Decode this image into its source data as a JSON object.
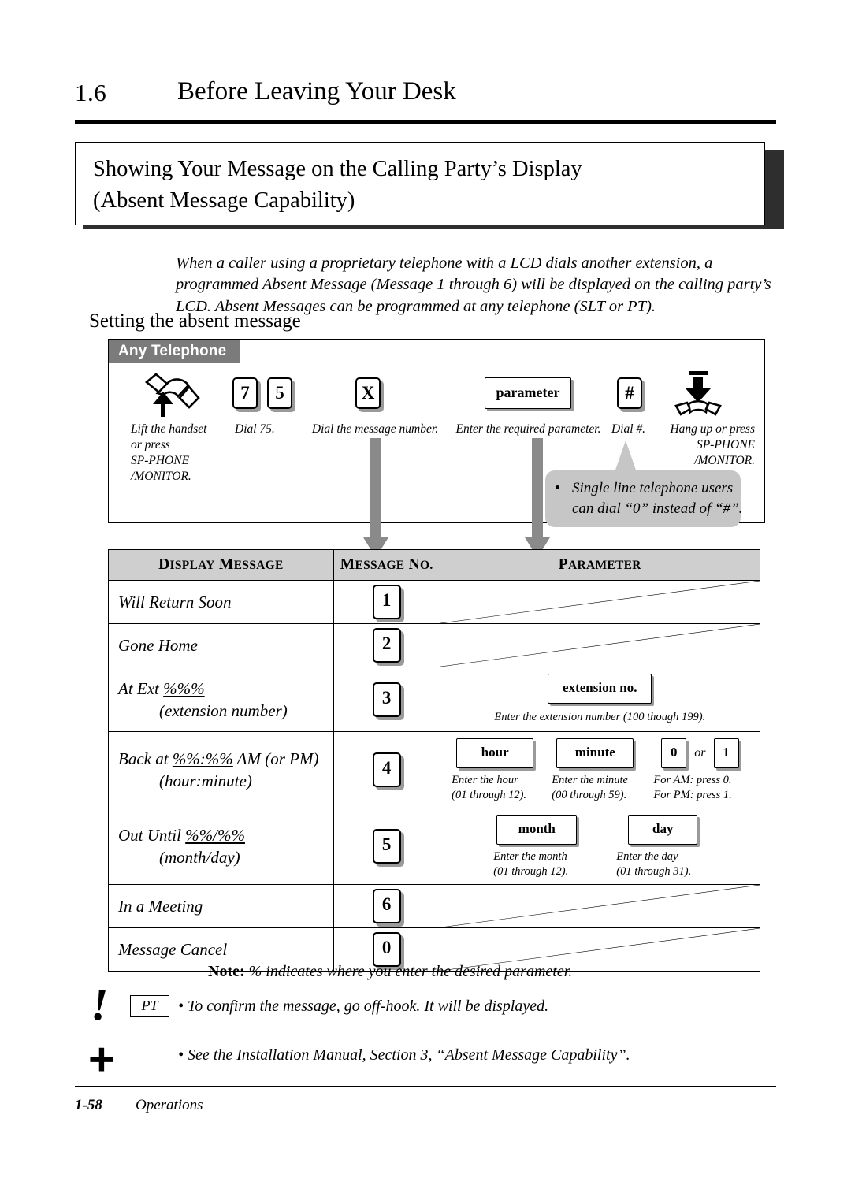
{
  "header": {
    "section_number": "1.6",
    "section_title": "Before Leaving Your Desk"
  },
  "feature": {
    "title_line1": "Showing Your Message on the Calling Party’s Display",
    "title_line2": "(Absent Message Capability)"
  },
  "intro": "When a caller using a proprietary telephone with a LCD dials another extension, a programmed Absent Message (Message 1 through 6) will be displayed on the calling party’s LCD. Absent Messages can be programmed at any telephone (SLT or PT).",
  "subheading": "Setting the absent message",
  "panel": {
    "tab_label": "Any Telephone",
    "steps": [
      {
        "icon": "lift-handset-icon",
        "keys": [],
        "caption": "Lift the handset\nor press\nSP-PHONE\n/MONITOR."
      },
      {
        "icon": null,
        "keys": [
          "7",
          "5"
        ],
        "caption": "Dial 75."
      },
      {
        "icon": null,
        "keys": [
          "X"
        ],
        "caption": "Dial the message number."
      },
      {
        "icon": null,
        "keys": [
          "parameter"
        ],
        "caption": "Enter the required parameter."
      },
      {
        "icon": null,
        "keys": [
          "#"
        ],
        "caption": "Dial #."
      },
      {
        "icon": "hang-up-icon",
        "keys": [],
        "caption": "Hang up or press\nSP-PHONE\n/MONITOR."
      }
    ],
    "callout": {
      "bullet": "•",
      "line1": "Single line telephone users",
      "line2": "can dial “0” instead of “#”."
    }
  },
  "table": {
    "columns": [
      "Display Message",
      "Message No.",
      "Parameter"
    ],
    "rows": [
      {
        "display_message": "Will Return Soon",
        "display_message_sub": "",
        "message_no": "1",
        "parameter_type": "none"
      },
      {
        "display_message": "Gone Home",
        "display_message_sub": "",
        "message_no": "2",
        "parameter_type": "none"
      },
      {
        "display_message": "At Ext %%%",
        "display_message_sub": "(extension number)",
        "message_no": "3",
        "parameter_type": "fields",
        "fields": [
          {
            "box": "extension no.",
            "caption": "Enter the extension number (100 though 199)."
          }
        ]
      },
      {
        "display_message": "Back at %%:%% AM (or PM)",
        "display_message_sub": "(hour:minute)",
        "message_no": "4",
        "parameter_type": "fields",
        "fields": [
          {
            "box": "hour",
            "caption": "Enter the hour\n(01 through 12)."
          },
          {
            "box": "minute",
            "caption": "Enter the minute\n(00 through 59)."
          },
          {
            "box": "0",
            "box2": "1",
            "joiner": "or",
            "caption": "For AM: press 0.\nFor PM: press 1."
          }
        ]
      },
      {
        "display_message": "Out Until %%/%%",
        "display_message_sub": "(month/day)",
        "message_no": "5",
        "parameter_type": "fields",
        "fields": [
          {
            "box": "month",
            "caption": "Enter the month\n(01 through 12)."
          },
          {
            "box": "day",
            "caption": "Enter the day\n(01 through 31)."
          }
        ]
      },
      {
        "display_message": "In a Meeting",
        "display_message_sub": "",
        "message_no": "6",
        "parameter_type": "none"
      },
      {
        "display_message": "Message Cancel",
        "display_message_sub": "",
        "message_no": "0",
        "parameter_type": "none"
      }
    ]
  },
  "notes": {
    "note_label": "Note:",
    "note_text": "% indicates where you enter the desired parameter.",
    "pt_badge": "PT",
    "warning_symbol": "!",
    "reference_symbol": "+",
    "bullet1": "• To confirm the message, go off-hook. It will be displayed.",
    "bullet2": "• See the Installation Manual, Section 3, “Absent Message Capability”."
  },
  "footer": {
    "page_number": "1-58",
    "section_label": "Operations"
  },
  "colors": {
    "tab_gray": "#7b7b7b",
    "table_header_gray": "#cfcfcf",
    "arrow_gray": "#8a8a8a",
    "callout_gray": "#c6c6c6",
    "shadow_dark": "#2e2e2e"
  }
}
